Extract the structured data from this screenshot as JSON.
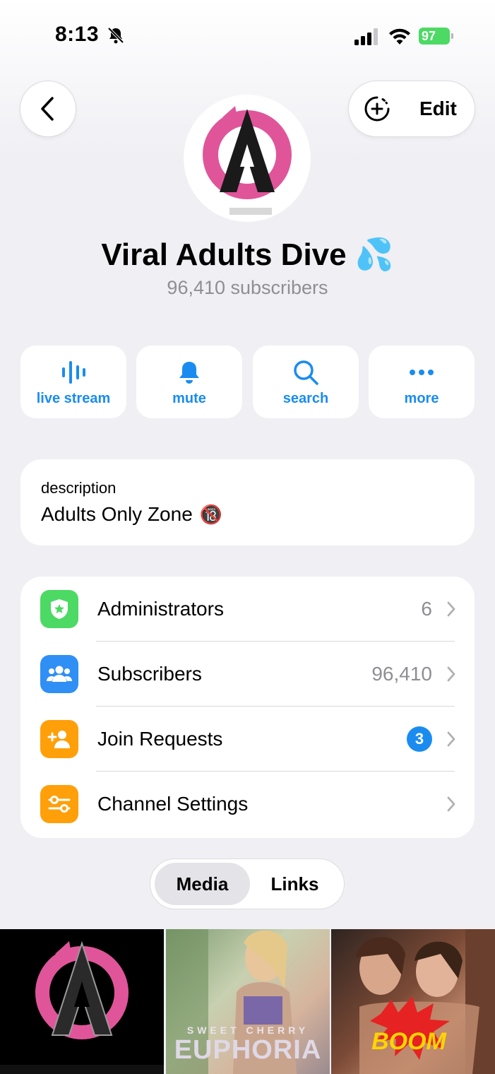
{
  "status_bar": {
    "time": "8:13",
    "battery": "97"
  },
  "header": {
    "edit_label": "Edit"
  },
  "channel": {
    "name": "Viral Adults Dive 💦",
    "subscribers_text": "96,410 subscribers"
  },
  "actions": [
    {
      "label": "live stream",
      "icon": "live-stream-icon"
    },
    {
      "label": "mute",
      "icon": "bell-icon"
    },
    {
      "label": "search",
      "icon": "search-icon"
    },
    {
      "label": "more",
      "icon": "more-icon"
    }
  ],
  "description": {
    "title": "description",
    "text": "Adults Only Zone",
    "emoji": "🔞"
  },
  "list": [
    {
      "label": "Administrators",
      "value": "6",
      "icon": "shield-star-icon",
      "color": "#4cd964"
    },
    {
      "label": "Subscribers",
      "value": "96,410",
      "icon": "people-icon",
      "color": "#2f8ff4"
    },
    {
      "label": "Join Requests",
      "badge": "3",
      "icon": "add-person-icon",
      "color": "#ff9f0a"
    },
    {
      "label": "Channel Settings",
      "value": "",
      "icon": "settings-toggles-icon",
      "color": "#ff9f0a"
    }
  ],
  "tabs": {
    "media": "Media",
    "links": "Links"
  },
  "media": [
    {
      "caption": ""
    },
    {
      "caption": "SWEET CHERRY",
      "title": "EUPHORIA"
    },
    {
      "caption": "BOOM"
    }
  ],
  "colors": {
    "accent": "#1a8cf0",
    "background": "#efeff4",
    "secondary_text": "#8e8e93"
  }
}
